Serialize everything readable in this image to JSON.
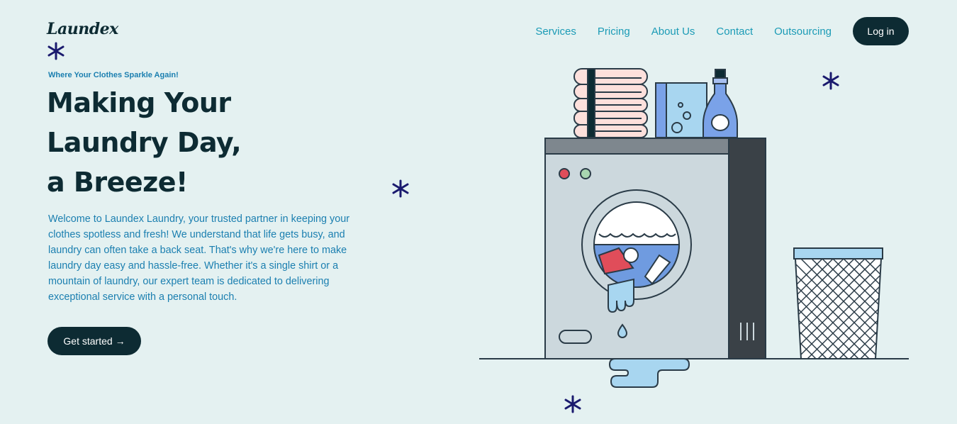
{
  "brand": {
    "logo": "Laundex"
  },
  "nav": {
    "items": [
      "Services",
      "Pricing",
      "About Us",
      "Contact",
      "Outsourcing"
    ],
    "login_label": "Log in"
  },
  "hero": {
    "tagline": "Where Your Clothes Sparkle Again!",
    "headline": [
      "Making Your",
      "Laundry Day,",
      "a Breeze!"
    ],
    "description": "Welcome to Laundex Laundry, your trusted partner in keeping your clothes spotless and fresh! We understand that life gets busy, and laundry can often take a back seat. That's why we're here to make laundry day easy and hassle-free. Whether it's a single shirt or a mountain of laundry, our expert team is dedicated to delivering exceptional service with a personal touch.",
    "cta_label": "Get started →"
  },
  "icons": {
    "decor": "asterisk-star-icon",
    "illustration": "washing-machine-illustration"
  },
  "colors": {
    "background": "#e4f1f1",
    "primary_dark": "#0d2b33",
    "accent": "#1b9bb6",
    "text_blue": "#1b7fb0",
    "star": "#1a1a6e"
  }
}
